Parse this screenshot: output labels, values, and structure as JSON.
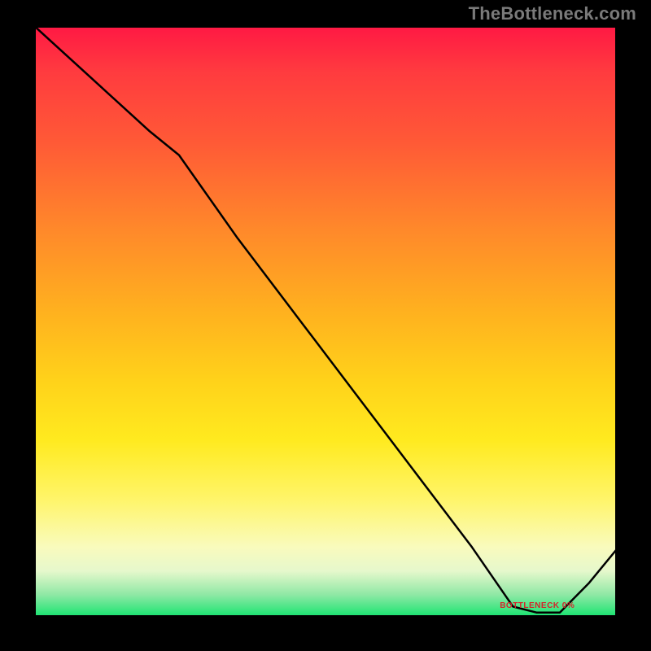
{
  "watermark": "TheBottleneck.com",
  "tiny_label": "BOTTLENECK 0%",
  "chart_data": {
    "type": "line",
    "title": "",
    "xlabel": "",
    "ylabel": "",
    "xlim": [
      0,
      100
    ],
    "ylim": [
      0,
      100
    ],
    "grid": false,
    "legend": false,
    "description": "Bottleneck curve over a red→green heat gradient. Curve starts at top-left (100%), descends with a slight knee near x≈25, reaches ~0% around x≈82–90, then rises toward ~12% at x=100.",
    "series": [
      {
        "name": "bottleneck",
        "x": [
          0,
          10,
          20,
          25,
          35,
          45,
          55,
          65,
          75,
          82,
          86,
          90,
          95,
          100
        ],
        "y": [
          100,
          91,
          82,
          78,
          64,
          51,
          38,
          25,
          12,
          2,
          1,
          1,
          6,
          12
        ]
      }
    ],
    "colors": {
      "curve": "#000000",
      "gradient_top": "#ff1744",
      "gradient_mid": "#ffd21a",
      "gradient_bottom": "#12d76a",
      "label": "#d4232a"
    }
  }
}
